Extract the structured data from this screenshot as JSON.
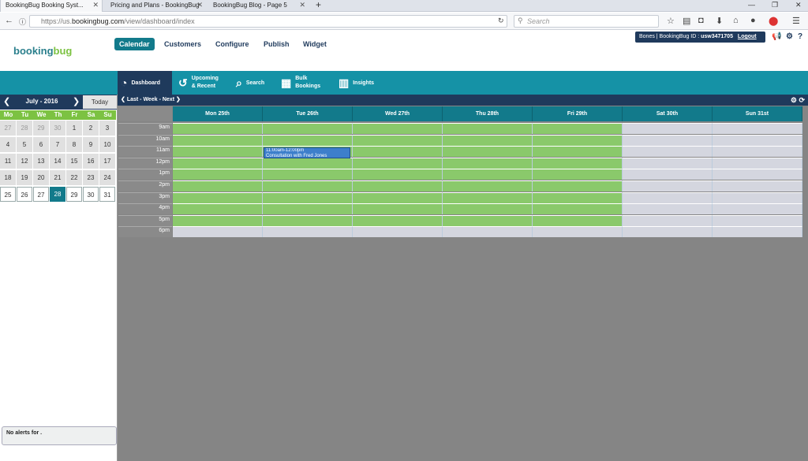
{
  "browser": {
    "tabs": [
      "BookingBug Booking Syst...",
      "Pricing and Plans - BookingBug",
      "BookingBug Blog - Page 5"
    ],
    "url_prefix": "https://us.",
    "url_domain": "bookingbug.com",
    "url_path": "/view/dashboard/index",
    "search_placeholder": "Search"
  },
  "app": {
    "logo_main": "booking",
    "logo_accent": "bug",
    "nav": [
      "Calendar",
      "Customers",
      "Configure",
      "Publish",
      "Widget"
    ],
    "user_prefix": "Bones | BookingBug ID : ",
    "user_id": "usw3471705",
    "logout": "Logout",
    "subnav": [
      {
        "label": "Dashboard",
        "icon": "dashboard-icon"
      },
      {
        "label": "Upcoming & Recent",
        "icon": "history-icon"
      },
      {
        "label": "Search",
        "icon": "search-icon"
      },
      {
        "label": "Bulk Bookings",
        "icon": "grid-icon"
      },
      {
        "label": "Insights",
        "icon": "bar-chart-icon"
      }
    ]
  },
  "mini_calendar": {
    "month": "July - 2016",
    "today_label": "Today",
    "weekdays": [
      "Mo",
      "Tu",
      "We",
      "Th",
      "Fr",
      "Sa",
      "Su"
    ],
    "weeks": [
      [
        "27",
        "28",
        "29",
        "30",
        "1",
        "2",
        "3"
      ],
      [
        "4",
        "5",
        "6",
        "7",
        "8",
        "9",
        "10"
      ],
      [
        "11",
        "12",
        "13",
        "14",
        "15",
        "16",
        "17"
      ],
      [
        "18",
        "19",
        "20",
        "21",
        "22",
        "23",
        "24"
      ],
      [
        "25",
        "26",
        "27",
        "28",
        "29",
        "30",
        "31"
      ]
    ],
    "selected_day": "28"
  },
  "alerts_text": "No alerts for .",
  "week_nav": {
    "last": "Last",
    "week": "Week",
    "next": "Next"
  },
  "calendar": {
    "days": [
      "Mon 25th",
      "Tue 26th",
      "Wed 27th",
      "Thu 28th",
      "Fri 29th",
      "Sat 30th",
      "Sun 31st"
    ],
    "hours": [
      "9am",
      "10am",
      "11am",
      "12pm",
      "1pm",
      "2pm",
      "3pm",
      "4pm",
      "5pm",
      "6pm"
    ],
    "appointment": {
      "time": "11:00am-12:00pm",
      "title": "Consultation with Fred Jones"
    }
  },
  "colors": {
    "teal": "#127a8b",
    "navy": "#1f3a5c",
    "green": "#8ac96b",
    "appt_blue": "#3d7fcb"
  }
}
